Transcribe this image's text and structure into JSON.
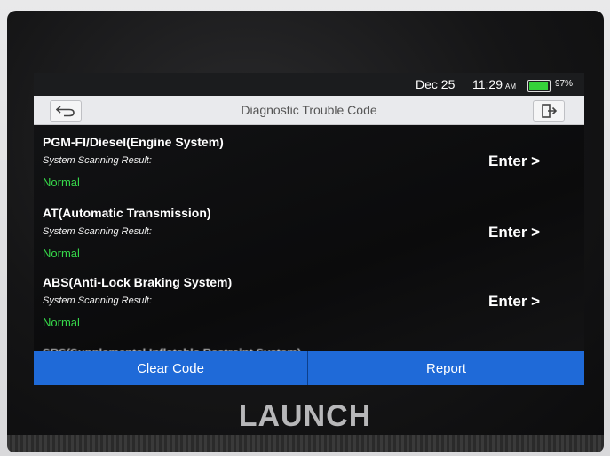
{
  "status_bar": {
    "date": "Dec 25",
    "time": "11:29",
    "ampm": "AM",
    "battery_percent_label": "97%",
    "battery_level": 0.97,
    "battery_color": "#35d13a"
  },
  "header": {
    "title": "Diagnostic Trouble Code",
    "back_icon": "back-arrow-icon",
    "exit_icon": "exit-icon"
  },
  "systems": [
    {
      "name": "PGM-FI/Diesel(Engine System)",
      "result_label": "System Scanning Result:",
      "status": "Normal",
      "action": "Enter >"
    },
    {
      "name": "AT(Automatic Transmission)",
      "result_label": "System Scanning Result:",
      "status": "Normal",
      "action": "Enter >"
    },
    {
      "name": "ABS(Anti-Lock Braking System)",
      "result_label": "System Scanning Result:",
      "status": "Normal",
      "action": "Enter >"
    },
    {
      "name": "SRS(Supplemental Inflatable Restraint System)"
    }
  ],
  "footer": {
    "clear_label": "Clear Code",
    "report_label": "Report",
    "accent_color": "#1f6ad8"
  },
  "device_brand": "LAUNCH",
  "status_normal_color": "#36d84a"
}
